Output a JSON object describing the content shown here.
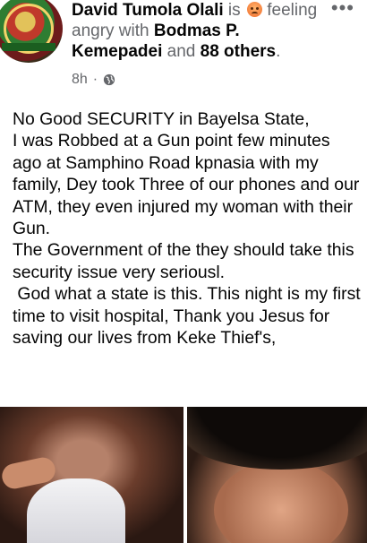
{
  "post": {
    "author": "David Tumola Olali",
    "verb": "is",
    "feeling_text": "feeling angry with",
    "tagged_name": "Bodmas P. Kemepadei",
    "conjunction": "and",
    "others": "88 others",
    "period": ".",
    "timestamp": "8h",
    "separator": "·",
    "privacy_icon": "globe-icon",
    "feeling_icon": "angry-emoji-icon",
    "more_icon": "more-options-icon",
    "more_glyph": "•••",
    "body": "No Good SECURITY in Bayelsa State,\nI was Robbed at a Gun point few minutes ago at Samphino Road kpnasia with my family, Dey took Three of our phones and our ATM, they even injured my woman with their Gun.\nThe Government of the they should take this security issue very seriousl.\n God what a state is this. This night is my first time to visit hospital, Thank you Jesus for saving our lives from Keke Thief's,"
  },
  "colors": {
    "name": "#050505",
    "secondary": "#65676b",
    "background": "#ffffff"
  }
}
